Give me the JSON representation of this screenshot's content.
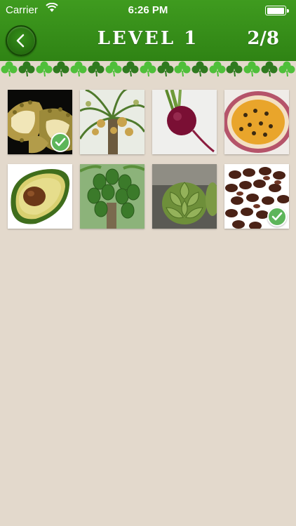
{
  "status_bar": {
    "carrier": "Carrier",
    "time": "6:26 PM"
  },
  "header": {
    "title": "LEVEL 1",
    "progress": "2/8",
    "back_icon": "chevron-left-icon"
  },
  "colors": {
    "header_green": "#2f8314",
    "background": "#e3d9cc",
    "check_green": "#5db55a"
  },
  "tiles": [
    {
      "subject": "durian",
      "solved": true
    },
    {
      "subject": "date palm",
      "solved": false
    },
    {
      "subject": "beetroot",
      "solved": false
    },
    {
      "subject": "passion fruit",
      "solved": false
    },
    {
      "subject": "avocado",
      "solved": false
    },
    {
      "subject": "papaya",
      "solved": false
    },
    {
      "subject": "artichoke",
      "solved": false
    },
    {
      "subject": "raisins",
      "solved": true
    }
  ]
}
